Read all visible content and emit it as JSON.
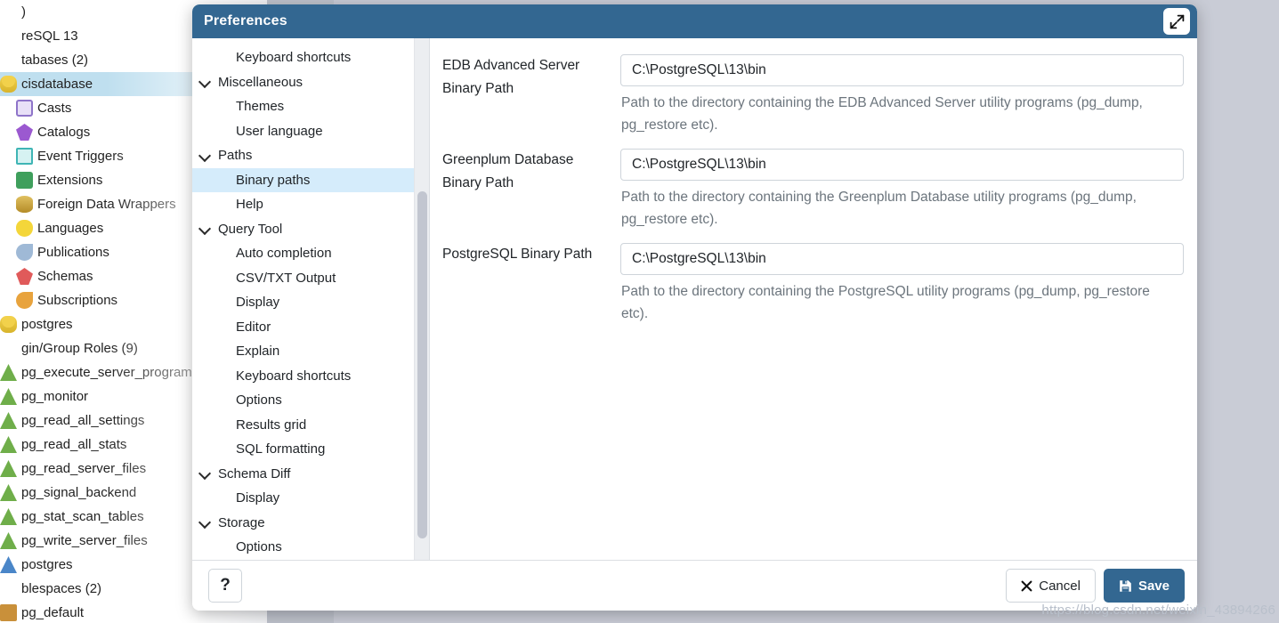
{
  "background": {
    "tree_items": [
      {
        "label": ")",
        "icon": "none",
        "indent": 0,
        "selected": false
      },
      {
        "label": "reSQL 13",
        "icon": "none",
        "indent": 0,
        "selected": false
      },
      {
        "label": "tabases (2)",
        "icon": "none",
        "indent": 0,
        "selected": false
      },
      {
        "label": "cisdatabase",
        "icon": "database",
        "indent": 0,
        "selected": true
      },
      {
        "label": "Casts",
        "icon": "cast",
        "indent": 18,
        "selected": false
      },
      {
        "label": "Catalogs",
        "icon": "catalog",
        "indent": 18,
        "selected": false
      },
      {
        "label": "Event Triggers",
        "icon": "event",
        "indent": 18,
        "selected": false
      },
      {
        "label": "Extensions",
        "icon": "extension",
        "indent": 18,
        "selected": false
      },
      {
        "label": "Foreign Data Wrappers",
        "icon": "fdw",
        "indent": 18,
        "selected": false
      },
      {
        "label": "Languages",
        "icon": "language",
        "indent": 18,
        "selected": false
      },
      {
        "label": "Publications",
        "icon": "publication",
        "indent": 18,
        "selected": false
      },
      {
        "label": "Schemas",
        "icon": "schema",
        "indent": 18,
        "selected": false
      },
      {
        "label": "Subscriptions",
        "icon": "subscription",
        "indent": 18,
        "selected": false
      },
      {
        "label": "postgres",
        "icon": "database",
        "indent": 0,
        "selected": false
      },
      {
        "label": "gin/Group Roles (9)",
        "icon": "none",
        "indent": 0,
        "selected": false
      },
      {
        "label": "pg_execute_server_program",
        "icon": "role",
        "indent": 0,
        "selected": false
      },
      {
        "label": "pg_monitor",
        "icon": "role",
        "indent": 0,
        "selected": false
      },
      {
        "label": "pg_read_all_settings",
        "icon": "role",
        "indent": 0,
        "selected": false
      },
      {
        "label": "pg_read_all_stats",
        "icon": "role",
        "indent": 0,
        "selected": false
      },
      {
        "label": "pg_read_server_files",
        "icon": "role",
        "indent": 0,
        "selected": false
      },
      {
        "label": "pg_signal_backend",
        "icon": "role",
        "indent": 0,
        "selected": false
      },
      {
        "label": "pg_stat_scan_tables",
        "icon": "role",
        "indent": 0,
        "selected": false
      },
      {
        "label": "pg_write_server_files",
        "icon": "role",
        "indent": 0,
        "selected": false
      },
      {
        "label": "postgres",
        "icon": "role-blue",
        "indent": 0,
        "selected": false
      },
      {
        "label": "blespaces (2)",
        "icon": "none",
        "indent": 0,
        "selected": false
      },
      {
        "label": "pg_default",
        "icon": "tablespace",
        "indent": 0,
        "selected": false
      }
    ]
  },
  "dialog": {
    "title": "Preferences",
    "expand_icon": "expand-diagonal-icon",
    "nav": {
      "items": [
        {
          "label": "Keyboard shortcuts",
          "type": "leaf",
          "selected": false
        },
        {
          "label": "Miscellaneous",
          "type": "group",
          "selected": false,
          "expanded": true
        },
        {
          "label": "Themes",
          "type": "leaf",
          "selected": false
        },
        {
          "label": "User language",
          "type": "leaf",
          "selected": false
        },
        {
          "label": "Paths",
          "type": "group",
          "selected": false,
          "expanded": true
        },
        {
          "label": "Binary paths",
          "type": "leaf",
          "selected": true
        },
        {
          "label": "Help",
          "type": "leaf",
          "selected": false
        },
        {
          "label": "Query Tool",
          "type": "group",
          "selected": false,
          "expanded": true
        },
        {
          "label": "Auto completion",
          "type": "leaf",
          "selected": false
        },
        {
          "label": "CSV/TXT Output",
          "type": "leaf",
          "selected": false
        },
        {
          "label": "Display",
          "type": "leaf",
          "selected": false
        },
        {
          "label": "Editor",
          "type": "leaf",
          "selected": false
        },
        {
          "label": "Explain",
          "type": "leaf",
          "selected": false
        },
        {
          "label": "Keyboard shortcuts",
          "type": "leaf",
          "selected": false
        },
        {
          "label": "Options",
          "type": "leaf",
          "selected": false
        },
        {
          "label": "Results grid",
          "type": "leaf",
          "selected": false
        },
        {
          "label": "SQL formatting",
          "type": "leaf",
          "selected": false
        },
        {
          "label": "Schema Diff",
          "type": "group",
          "selected": false,
          "expanded": true
        },
        {
          "label": "Display",
          "type": "leaf",
          "selected": false
        },
        {
          "label": "Storage",
          "type": "group",
          "selected": false,
          "expanded": true
        },
        {
          "label": "Options",
          "type": "leaf",
          "selected": false
        }
      ]
    },
    "fields": [
      {
        "label": "EDB Advanced Server Binary Path",
        "value": "C:\\PostgreSQL\\13\\bin",
        "help": "Path to the directory containing the EDB Advanced Server utility programs (pg_dump, pg_restore etc)."
      },
      {
        "label": "Greenplum Database Binary Path",
        "value": "C:\\PostgreSQL\\13\\bin",
        "help": "Path to the directory containing the Greenplum Database utility programs (pg_dump, pg_restore etc)."
      },
      {
        "label": "PostgreSQL Binary Path",
        "value": "C:\\PostgreSQL\\13\\bin",
        "help": "Path to the directory containing the PostgreSQL utility programs (pg_dump, pg_restore etc)."
      }
    ],
    "footer": {
      "help_label": "?",
      "cancel_label": "Cancel",
      "cancel_icon": "close-x-icon",
      "save_label": "Save",
      "save_icon": "floppy-save-icon"
    }
  },
  "watermark": "https://blog.csdn.net/weixin_43894266",
  "colors": {
    "title_bar": "#336791",
    "accent": "#336791",
    "nav_selected_bg": "#d5ecfb",
    "tree_selected_bg": "#bfdfef",
    "help_text": "#6c757d"
  }
}
